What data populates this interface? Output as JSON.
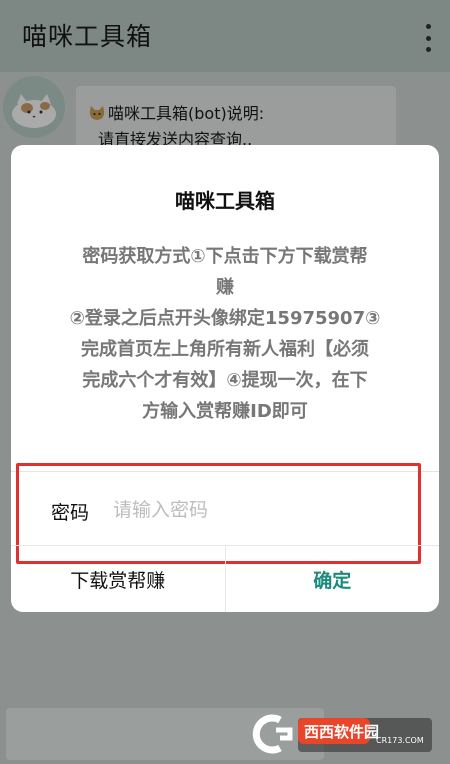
{
  "app": {
    "title": "喵咪工具箱"
  },
  "chat": {
    "bubble_line1": "喵咪工具箱(bot)说明:",
    "bubble_line2": "请直接发送内容查询.."
  },
  "dialog": {
    "title": "喵咪工具箱",
    "message": "密码获取方式①下点击下方下载赏帮\n赚\n②登录之后点开头像绑定15975907③\n完成首页左上角所有新人福利【必须\n完成六个才有效】④提现一次，在下\n方输入赏帮赚ID即可",
    "field_label": "密码",
    "field_placeholder": "请输入密码",
    "field_value": "",
    "btn_left": "下载赏帮赚",
    "btn_right": "确定"
  },
  "watermark": {
    "logo_text": "西西软件园",
    "domain": "CR173.COM"
  },
  "colors": {
    "accent": "#1a8b7c",
    "highlight": "#e0312e"
  },
  "icons": {
    "menu": "more-vert-icon",
    "avatar": "cat-avatar",
    "bubble_emoji": "cat-emoji-icon"
  }
}
